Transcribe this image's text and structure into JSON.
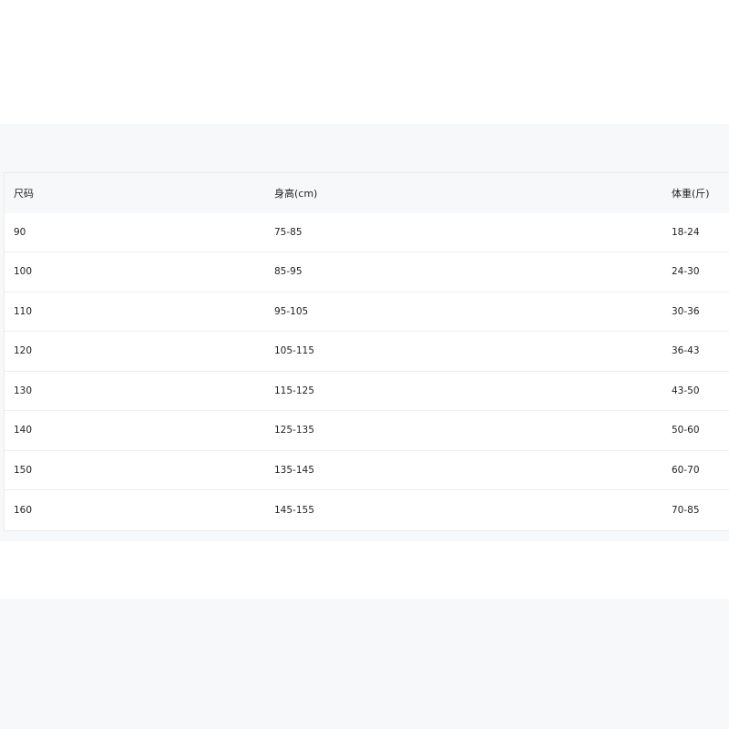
{
  "size_table": {
    "columns": [
      "尺码",
      "身高(cm)",
      "体重(斤)"
    ],
    "rows": [
      [
        "90",
        "75-85",
        "18-24"
      ],
      [
        "100",
        "85-95",
        "24-30"
      ],
      [
        "110",
        "95-105",
        "30-36"
      ],
      [
        "120",
        "105-115",
        "36-43"
      ],
      [
        "130",
        "115-125",
        "43-50"
      ],
      [
        "140",
        "125-135",
        "50-60"
      ],
      [
        "150",
        "135-145",
        "60-70"
      ],
      [
        "160",
        "145-155",
        "70-85"
      ]
    ]
  },
  "colors": {
    "panel_background": "#f7f8fa",
    "table_background": "#ffffff",
    "row_divider": "#efefef",
    "text": "#222222"
  }
}
